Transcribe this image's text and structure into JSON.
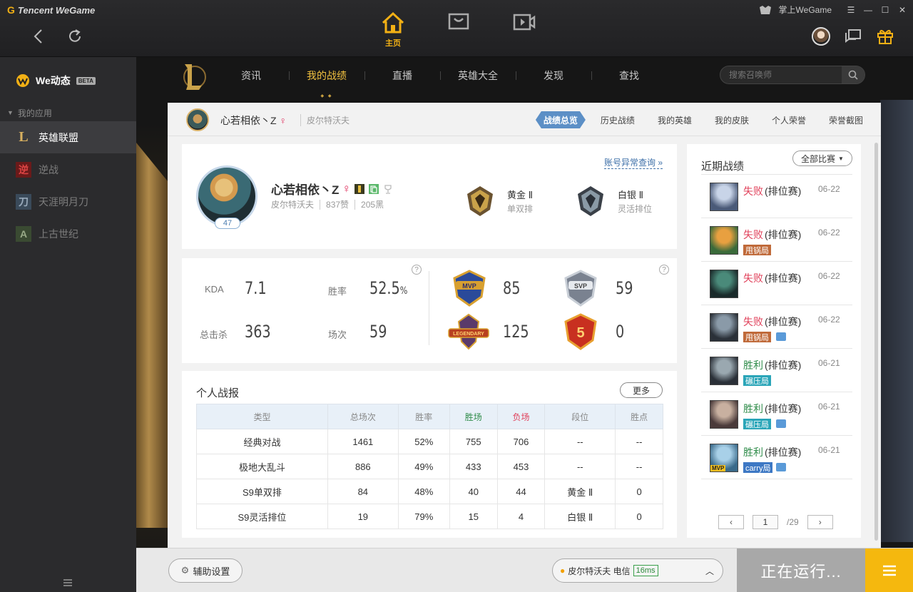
{
  "app": {
    "logo_text": "Tencent WeGame"
  },
  "top_tabs": [
    {
      "label": "主页",
      "icon": "home-icon"
    },
    {
      "label": "",
      "icon": "store-icon"
    },
    {
      "label": "",
      "icon": "video-icon"
    }
  ],
  "window": {
    "mobile_label": "掌上WeGame"
  },
  "sidebar": {
    "title": "We动态",
    "beta": "BETA",
    "apps_header": "我的应用",
    "items": [
      {
        "label": "英雄联盟",
        "icon": "lol-icon"
      },
      {
        "label": "逆战",
        "icon": "nizhan-icon"
      },
      {
        "label": "天涯明月刀",
        "icon": "tianya-icon"
      },
      {
        "label": "上古世纪",
        "icon": "archeage-icon"
      }
    ]
  },
  "lol_nav": {
    "tabs": [
      "资讯",
      "我的战绩",
      "直播",
      "英雄大全",
      "发现",
      "查找"
    ],
    "active_tab": "我的战绩",
    "search_placeholder": "搜索召唤师"
  },
  "sub_header": {
    "name": "心若相依丶Z",
    "gender": "♀",
    "server": "皮尔特沃夫",
    "tabs": [
      "战绩总览",
      "历史战绩",
      "我的英雄",
      "我的皮肤",
      "个人荣誉",
      "荣誉截图"
    ],
    "active_tab": "战绩总览"
  },
  "profile": {
    "name": "心若相依丶Z",
    "gender": "♀",
    "level": "47",
    "server": "皮尔特沃夫",
    "likes": "837赞",
    "dislikes": "205黑",
    "account_link": "账号异常查询 »",
    "ranks": [
      {
        "tier": "黄金 Ⅱ",
        "queue": "单双排",
        "color": "#c9a24a"
      },
      {
        "tier": "白银 Ⅱ",
        "queue": "灵活排位",
        "color": "#8a9aa6"
      }
    ]
  },
  "stats": {
    "kda_label": "KDA",
    "kda": "7.1",
    "winrate_label": "胜率",
    "winrate": "52.5",
    "winrate_unit": "%",
    "kills_label": "总击杀",
    "kills": "363",
    "games_label": "场次",
    "games": "59",
    "badges": [
      {
        "name": "MVP",
        "count": "85"
      },
      {
        "name": "SVP",
        "count": "59"
      },
      {
        "name": "LEGENDARY",
        "count": "125"
      },
      {
        "name": "5",
        "count": "0"
      }
    ],
    "help": "?"
  },
  "report": {
    "title": "个人战报",
    "more": "更多",
    "headers": [
      "类型",
      "总场次",
      "胜率",
      "胜场",
      "负场",
      "段位",
      "胜点"
    ],
    "rows": [
      [
        "经典对战",
        "1461",
        "52%",
        "755",
        "706",
        "--",
        "--"
      ],
      [
        "极地大乱斗",
        "886",
        "49%",
        "433",
        "453",
        "--",
        "--"
      ],
      [
        "S9单双排",
        "84",
        "48%",
        "40",
        "44",
        "黄金 Ⅱ",
        "0"
      ],
      [
        "S9灵活排位",
        "19",
        "79%",
        "15",
        "4",
        "白银 Ⅱ",
        "0"
      ]
    ]
  },
  "recent": {
    "title": "近期战绩",
    "filter": "全部比赛",
    "matches": [
      {
        "result": "失败",
        "win": false,
        "mode": "(排位赛)",
        "date": "06-22",
        "tag": "",
        "tag_color": "",
        "pic": false,
        "mvp": false,
        "champ_colors": [
          "#c8d4e8",
          "#4a5a78"
        ]
      },
      {
        "result": "失败",
        "win": false,
        "mode": "(排位赛)",
        "date": "06-22",
        "tag": "甩锅局",
        "tag_color": "orange",
        "pic": false,
        "mvp": false,
        "champ_colors": [
          "#e8a040",
          "#3a6a3a"
        ]
      },
      {
        "result": "失败",
        "win": false,
        "mode": "(排位赛)",
        "date": "06-22",
        "tag": "",
        "tag_color": "",
        "pic": false,
        "mvp": false,
        "champ_colors": [
          "#4a8a7a",
          "#1a2a2a"
        ]
      },
      {
        "result": "失败",
        "win": false,
        "mode": "(排位赛)",
        "date": "06-22",
        "tag": "甩锅局",
        "tag_color": "orange",
        "pic": true,
        "mvp": false,
        "champ_colors": [
          "#8a9aa8",
          "#2a3038"
        ]
      },
      {
        "result": "胜利",
        "win": true,
        "mode": "(排位赛)",
        "date": "06-21",
        "tag": "碾压局",
        "tag_color": "teal",
        "pic": false,
        "mvp": false,
        "champ_colors": [
          "#9aa8b0",
          "#2a3038"
        ]
      },
      {
        "result": "胜利",
        "win": true,
        "mode": "(排位赛)",
        "date": "06-21",
        "tag": "碾压局",
        "tag_color": "teal",
        "pic": true,
        "mvp": false,
        "champ_colors": [
          "#c8b0a0",
          "#4a3a3a"
        ]
      },
      {
        "result": "胜利",
        "win": true,
        "mode": "(排位赛)",
        "date": "06-21",
        "tag": "carry局",
        "tag_color": "blue",
        "pic": true,
        "mvp": true,
        "champ_colors": [
          "#a8d0e8",
          "#3a6a8a"
        ]
      }
    ],
    "pager": {
      "current": "1",
      "total": "/29"
    }
  },
  "bottom": {
    "assist": "辅助设置",
    "server": "皮尔特沃夫 电信",
    "ping": "16ms",
    "running": "正在运行..."
  },
  "colors": {
    "accent": "#f2b015",
    "win": "#2f8c4a",
    "lose": "#e0405a",
    "active_tab": "#5c8fc6"
  }
}
